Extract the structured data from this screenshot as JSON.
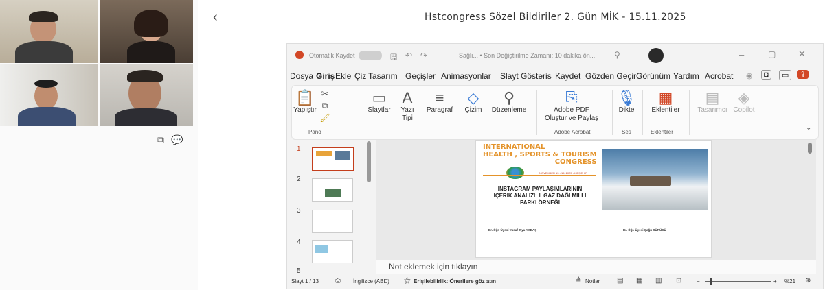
{
  "meeting": {
    "title": "Hstcongress Sözel Bildiriler 2. Gün MİK - 15.11.2025",
    "back_icon": "‹"
  },
  "ppt": {
    "autosave": "Otomatik Kaydet",
    "doc_status": "Sağlı... • Son Değiştirilme Zamanı: 10 dakika ön...",
    "menu": [
      "Dosya",
      "Giriş",
      "Ekle",
      "Çiz",
      "Tasarım",
      "Geçişler",
      "Animasyonlar",
      "Slayt Gösteris",
      "Kaydet",
      "Gözden Geçir",
      "Görünüm",
      "Yardım",
      "Acrobat"
    ],
    "ribbon": {
      "paste": "Yapıştır",
      "slides": "Slaytlar",
      "font": "Yazı Tipi",
      "paragraph": "Paragraf",
      "draw": "Çizim",
      "editing": "Düzenleme",
      "adobe_line1": "Adobe PDF",
      "adobe_line2": "Oluştur ve Paylaş",
      "dictate": "Dikte",
      "addins": "Eklentiler",
      "designer": "Tasarımcı",
      "copilot": "Copilot",
      "group_pano": "Pano",
      "group_adobe": "Adobe Acrobat",
      "group_ses": "Ses",
      "group_eklentiler": "Eklentiler"
    },
    "thumb_numbers": [
      "1",
      "2",
      "3",
      "4",
      "5"
    ],
    "slide": {
      "brand_line1": "INTERNATIONAL",
      "brand_line2": "HEALTH , SPORTS & TOURISM",
      "brand_line3": "CONGRESS",
      "dates": "NOVEMBER 13 - 15, 2025 - KIRŞEHİR",
      "title_line1": "INSTAGRAM PAYLAŞIMLARININ",
      "title_line2": "İÇERİK ANALİZİ: ILGAZ DAĞI MİLLİ",
      "title_line3": "PARKI ÖRNEĞİ",
      "author1": "Dr. Öğr. Üyesi Yusuf Ziya AKBAŞ",
      "author2": "Dr. Öğr. Üyesi Çağrı SÜRÜCÜ"
    },
    "notes_placeholder": "Not eklemek için tıklayın",
    "status": {
      "slide": "Slayt 1 / 13",
      "language": "İngilizce (ABD)",
      "accessibility": "Erişilebilirlik: Önerilere göz atın",
      "notes": "Notlar",
      "zoom": "%21"
    }
  }
}
